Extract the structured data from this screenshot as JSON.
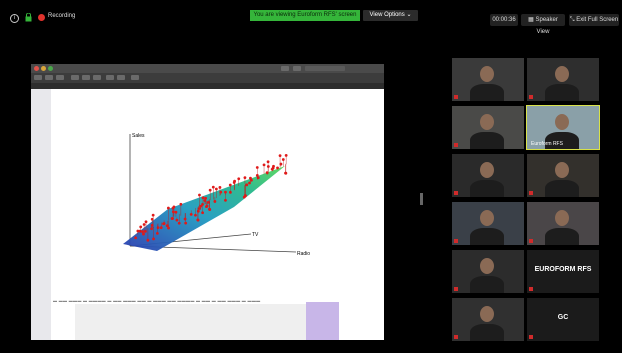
{
  "topbar": {
    "recording_label": "Recording",
    "banner": "You are viewing Euroform RFS' screen",
    "view_options": "View Options ⌄",
    "timer": "00:00:36",
    "speaker_view": "Speaker View",
    "exit_full_screen": "Exit Full Screen",
    "colors": {
      "banner": "#35b53a",
      "recording": "#e0322c"
    }
  },
  "share": {
    "toolbar_items": [
      "sidebar-toggle",
      "zoom-out",
      "zoom-in",
      "share",
      "pen",
      "search"
    ],
    "chart_data": {
      "type": "scatter-3d-plane",
      "axis_labels": {
        "vertical": "Sales",
        "depth": "TV",
        "horizontal": "Radio"
      }
    }
  },
  "participants": [
    {
      "name": "",
      "muted": true
    },
    {
      "name": "",
      "muted": true
    },
    {
      "name": "",
      "muted": true
    },
    {
      "name": "Euroform RFS",
      "muted": false,
      "active": true
    },
    {
      "name": "",
      "muted": true
    },
    {
      "name": "",
      "muted": true
    },
    {
      "name": "",
      "muted": true
    },
    {
      "name": "",
      "muted": true
    },
    {
      "name": "",
      "muted": true
    },
    {
      "name": "EUROFORM RFS",
      "muted": true,
      "label_center": true
    },
    {
      "name": "",
      "muted": true
    },
    {
      "name": "GC",
      "muted": true,
      "label_center": true
    }
  ]
}
